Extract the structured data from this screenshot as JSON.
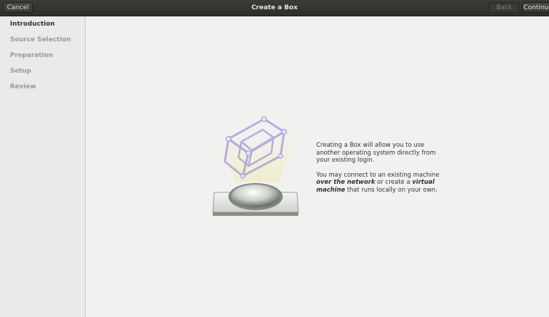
{
  "header": {
    "title": "Create a Box",
    "cancel_label": "Cancel",
    "back_label": "Back",
    "continue_label": "Continue"
  },
  "sidebar": {
    "items": [
      {
        "label": "Introduction",
        "active": true
      },
      {
        "label": "Source Selection",
        "active": false
      },
      {
        "label": "Preparation",
        "active": false
      },
      {
        "label": "Setup",
        "active": false
      },
      {
        "label": "Review",
        "active": false
      }
    ]
  },
  "intro": {
    "paragraph1": "Creating a Box will allow you to use another operating system directly from your existing login.",
    "p2_part1": "You may connect to an existing machine ",
    "p2_network": "over the network",
    "p2_part2": " or create a ",
    "p2_virtual": "virtual machine",
    "p2_part3": " that runs locally on your own."
  },
  "illustration": {
    "icon": "boxes-hypercube-icon"
  },
  "colors": {
    "titlebar": "#2f2e2b",
    "background": "#f2f1f0",
    "sidebar": "#ebeae8"
  }
}
